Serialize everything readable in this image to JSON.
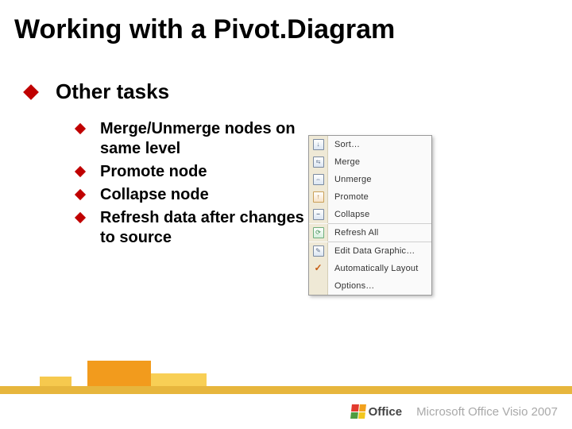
{
  "title": "Working with a Pivot.Diagram",
  "main_bullet": "Other tasks",
  "sub_bullets": [
    "Merge/Unmerge nodes on same level",
    "Promote node",
    "Collapse node",
    "Refresh data after changes to source"
  ],
  "context_menu": {
    "items": [
      {
        "icon": "sort",
        "label": "Sort…"
      },
      {
        "icon": "merge",
        "label": "Merge"
      },
      {
        "icon": "unmerge",
        "label": "Unmerge"
      },
      {
        "icon": "promote",
        "label": "Promote"
      },
      {
        "icon": "collapse",
        "label": "Collapse"
      },
      {
        "sep": true
      },
      {
        "icon": "refresh",
        "label": "Refresh All"
      },
      {
        "sep": true
      },
      {
        "icon": "edit",
        "label": "Edit Data Graphic…"
      },
      {
        "icon": "check",
        "label": "Automatically Layout"
      },
      {
        "icon": "",
        "label": "Options…"
      }
    ]
  },
  "footer": {
    "office_word": "Office",
    "product": "Microsoft Office Visio 2007"
  }
}
